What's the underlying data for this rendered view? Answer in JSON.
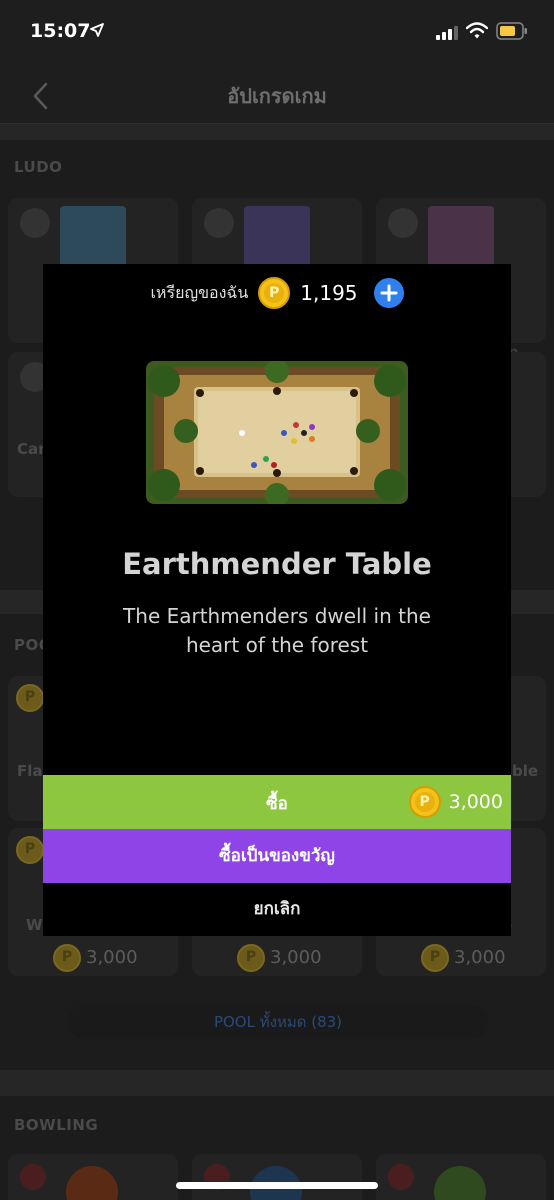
{
  "status_bar": {
    "time": "15:07"
  },
  "nav": {
    "title": "อัปเกรดเกม"
  },
  "sections": {
    "ludo": "LUDO",
    "pool": "POOL",
    "bowling": "BOWLING"
  },
  "background": {
    "ludo_card_text_left": "Car",
    "ludo_card_text_right_1": "n",
    "ludo_card_text_right_2": "e",
    "pool_card_text_left_1": "Fla",
    "pool_card_text_right_1": "ble",
    "pool_card_text_left_2": "W",
    "pool_card_text_right_2": "e",
    "prices": [
      "3,000",
      "3,000",
      "3,000"
    ],
    "pool_all_label": "POOL ทั้งหมด (83)"
  },
  "modal": {
    "wallet_label": "เหรียญของฉัน",
    "wallet_balance": "1,195",
    "item_title": "Earthmender Table",
    "item_description": "The Earthmenders dwell in the heart of the forest",
    "buy_label": "ซื้อ",
    "buy_price": "3,000",
    "gift_label": "ซื้อเป็นของขวัญ",
    "cancel_label": "ยกเลิก"
  },
  "colors": {
    "buy_green": "#8dc63f",
    "gift_purple": "#8e44e6",
    "coin_gold": "#f4c21b",
    "add_blue": "#2f80ed"
  },
  "icons": [
    "location-arrow-icon",
    "signal-icon",
    "wifi-icon",
    "battery-icon",
    "back-chevron-icon",
    "coin-icon",
    "plus-icon"
  ]
}
